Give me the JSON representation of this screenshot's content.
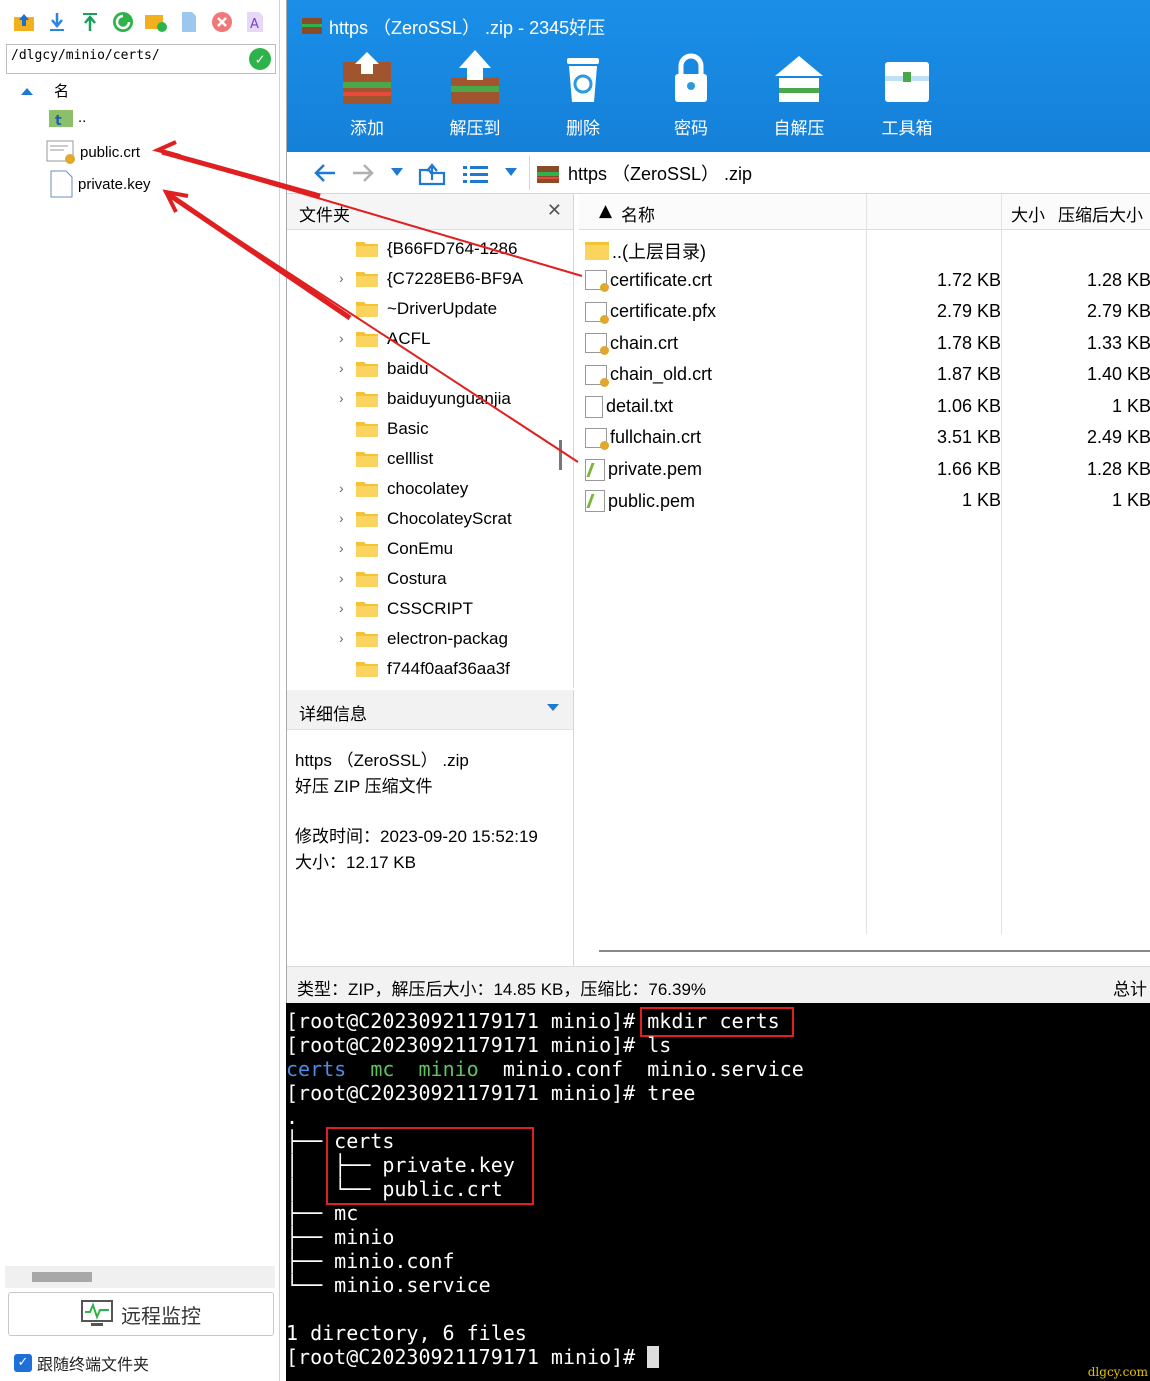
{
  "left": {
    "path": "/dlgcy/minio/certs/",
    "tree_header": "名",
    "items": [
      {
        "name": "..",
        "icon": "folder-up-icon"
      },
      {
        "name": "public.crt",
        "icon": "certificate-icon"
      },
      {
        "name": "private.key",
        "icon": "file-icon"
      }
    ],
    "remote_button": "远程监控",
    "follow_label": "跟随终端文件夹"
  },
  "archive": {
    "title": "https （ZeroSSL） .zip - 2345好压",
    "buttons": [
      "添加",
      "解压到",
      "删除",
      "密码",
      "自解压",
      "工具箱"
    ],
    "address": "https （ZeroSSL） .zip",
    "folder_header": "文件夹",
    "folders": [
      {
        "name": "{B66FD764-1286",
        "chevron": false
      },
      {
        "name": "{C7228EB6-BF9A",
        "chevron": true
      },
      {
        "name": "~DriverUpdate",
        "chevron": false
      },
      {
        "name": "ACFL",
        "chevron": true
      },
      {
        "name": "baidu",
        "chevron": true
      },
      {
        "name": "baiduyunguanjia",
        "chevron": true
      },
      {
        "name": "Basic",
        "chevron": false
      },
      {
        "name": "celllist",
        "chevron": false
      },
      {
        "name": "chocolatey",
        "chevron": true
      },
      {
        "name": "ChocolateyScrat",
        "chevron": true
      },
      {
        "name": "ConEmu",
        "chevron": true
      },
      {
        "name": "Costura",
        "chevron": true
      },
      {
        "name": "CSSCRIPT",
        "chevron": true
      },
      {
        "name": "electron-packag",
        "chevron": true
      },
      {
        "name": "f744f0aaf36aa3f",
        "chevron": false
      }
    ],
    "details": {
      "header": "详细信息",
      "name": "https （ZeroSSL） .zip",
      "type": "好压 ZIP 压缩文件",
      "modified": "修改时间：2023-09-20 15:52:19",
      "size": "大小：12.17 KB"
    },
    "columns": {
      "name": "名称",
      "size": "大小",
      "compressed": "压缩后大小"
    },
    "files": [
      {
        "name": "..(上层目录)",
        "icon": "folder",
        "size": "",
        "compressed": ""
      },
      {
        "name": "certificate.crt",
        "icon": "cert",
        "size": "1.72 KB",
        "compressed": "1.28 KB"
      },
      {
        "name": "certificate.pfx",
        "icon": "cert",
        "size": "2.79 KB",
        "compressed": "2.79 KB"
      },
      {
        "name": "chain.crt",
        "icon": "cert",
        "size": "1.78 KB",
        "compressed": "1.33 KB"
      },
      {
        "name": "chain_old.crt",
        "icon": "cert",
        "size": "1.87 KB",
        "compressed": "1.40 KB"
      },
      {
        "name": "detail.txt",
        "icon": "doc",
        "size": "1.06 KB",
        "compressed": "1 KB"
      },
      {
        "name": "fullchain.crt",
        "icon": "cert",
        "size": "3.51 KB",
        "compressed": "2.49 KB"
      },
      {
        "name": "private.pem",
        "icon": "pem",
        "size": "1.66 KB",
        "compressed": "1.28 KB"
      },
      {
        "name": "public.pem",
        "icon": "pem",
        "size": "1 KB",
        "compressed": "1 KB"
      }
    ],
    "status_left": "类型：ZIP，解压后大小：14.85 KB，压缩比：76.39%",
    "status_right": "总计"
  },
  "terminal": {
    "prompt": "[root@C20230921179171 minio]# ",
    "cmd1": "mkdir certs",
    "cmd2": "ls",
    "ls_certs": "certs",
    "ls_mc": "mc",
    "ls_minio": "minio",
    "ls_rest": "minio.conf  minio.service",
    "cmd3": "tree",
    "tree_dot": ".",
    "tree_lines": [
      "├── certs",
      "│   ├── private.key",
      "│   └── public.crt",
      "├── mc",
      "├── minio",
      "├── minio.conf",
      "└── minio.service"
    ],
    "summary": "1 directory, 6 files",
    "watermark": "dlgcy.com"
  },
  "colors": {
    "accent": "#1a8fe8",
    "arrow": "#e02020",
    "ok": "#2db34a",
    "checkbox": "#1e6fd9"
  }
}
